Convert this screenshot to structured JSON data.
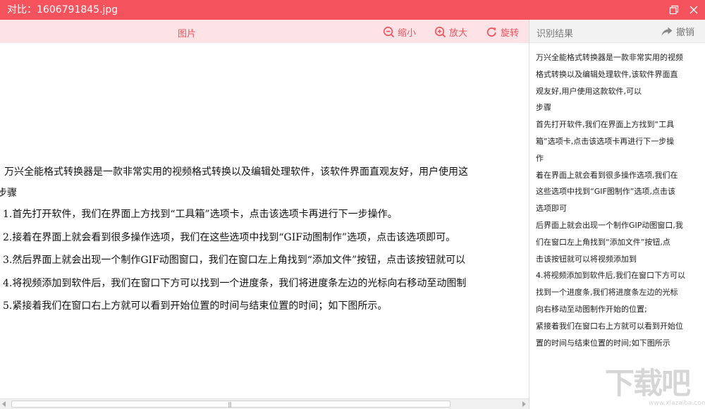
{
  "window": {
    "title": "对比：1606791845.jpg",
    "accent_color": "#f4525d"
  },
  "image_panel": {
    "header": "图片",
    "tools": {
      "zoom_out": "缩小",
      "zoom_in": "放大",
      "rotate": "旋转"
    },
    "lines": [
      "万兴全能格式转换器是一款非常实用的视频格式转换以及编辑处理软件，该软件界面直观友好，用户使用这",
      "步骤",
      "1.首先打开软件，我们在界面上方找到“工具箱”选项卡，点击该选项卡再进行下一步操作。",
      "2.接着在界面上就会看到很多操作选项，我们在这些选项中找到“GIF动图制作”选项，点击该选项即可。",
      "3.然后界面上就会出现一个制作GIF动图窗口，我们在窗口左上角找到“添加文件”按钮，点击该按钮就可以",
      "4.将视频添加到软件后，我们在窗口下方可以找到一个进度条，我们将进度条左边的光标向右移动至动图制",
      "5.紧接着我们在窗口右上方就可以看到开始位置的时间与结束位置的时间；如下图所示。"
    ]
  },
  "result_panel": {
    "header": "识别结果",
    "undo_label": "撤销",
    "lines": [
      "万兴全能格式转换器是一款非常实用的视频",
      "格式转换以及编辑处理软件,该软件界面直",
      "观友好,用户使用这款软件,可以",
      "步骤",
      "首先打开软件,我们在界面上方找到“工具",
      "箱”选项卡,点击该选项卡再进行下一步操",
      "作",
      "着在界面上就会看到很多操作选项,我们在",
      "这些选项中找到“GIF图制作”选项,点击该",
      "选项即可",
      "后界面上就会出现一个制作GIP动图窗口,我",
      "们在窗口左上角找到“添加文件”按钮,点",
      "击该按钮就可以将视频添加到",
      "4.将视频添加到软件后,我们在窗口下方可以",
      "找到一个进度条,我们将进度条左边的光标",
      "向右移动至动图制作开始的位置;",
      "紧接着我们在窗口右上方就可以看到开始位",
      "置的时间与结束位置的时间;如下图所示"
    ]
  },
  "watermark": {
    "text": "下载吧",
    "url": "www.xiazaiba.com"
  }
}
